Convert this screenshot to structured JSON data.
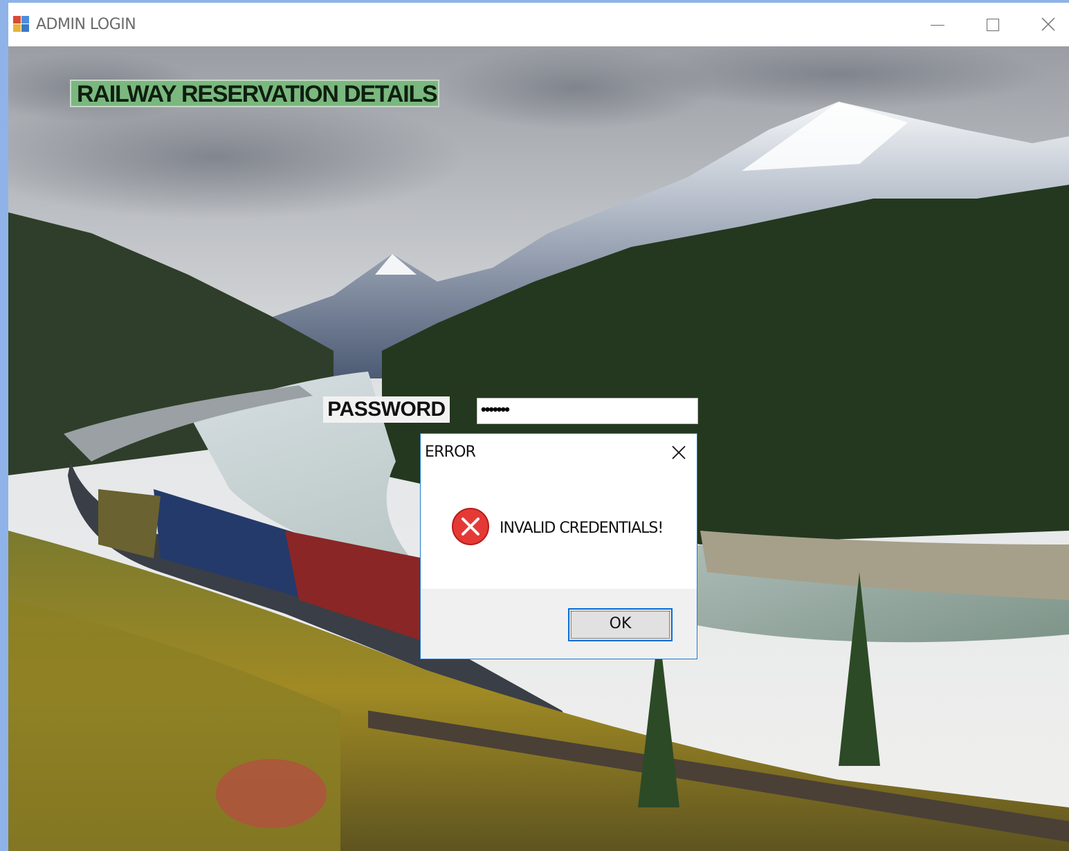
{
  "window": {
    "title": "ADMIN LOGIN",
    "controls": [
      "minimize-icon",
      "maximize-icon",
      "close-icon"
    ]
  },
  "form": {
    "heading": "RAILWAY RESERVATION DETAILS",
    "password_label": "PASSWORD",
    "password_value": "•••••••"
  },
  "dialog": {
    "title": "ERROR",
    "icon": "error-icon",
    "message": "INVALID CREDENTIALS!",
    "ok_label": "OK"
  },
  "colors": {
    "heading_bg": "#7ab87f",
    "dialog_border": "#1e7bd2",
    "error_red": "#e53935",
    "ok_border": "#0a6fd6"
  }
}
